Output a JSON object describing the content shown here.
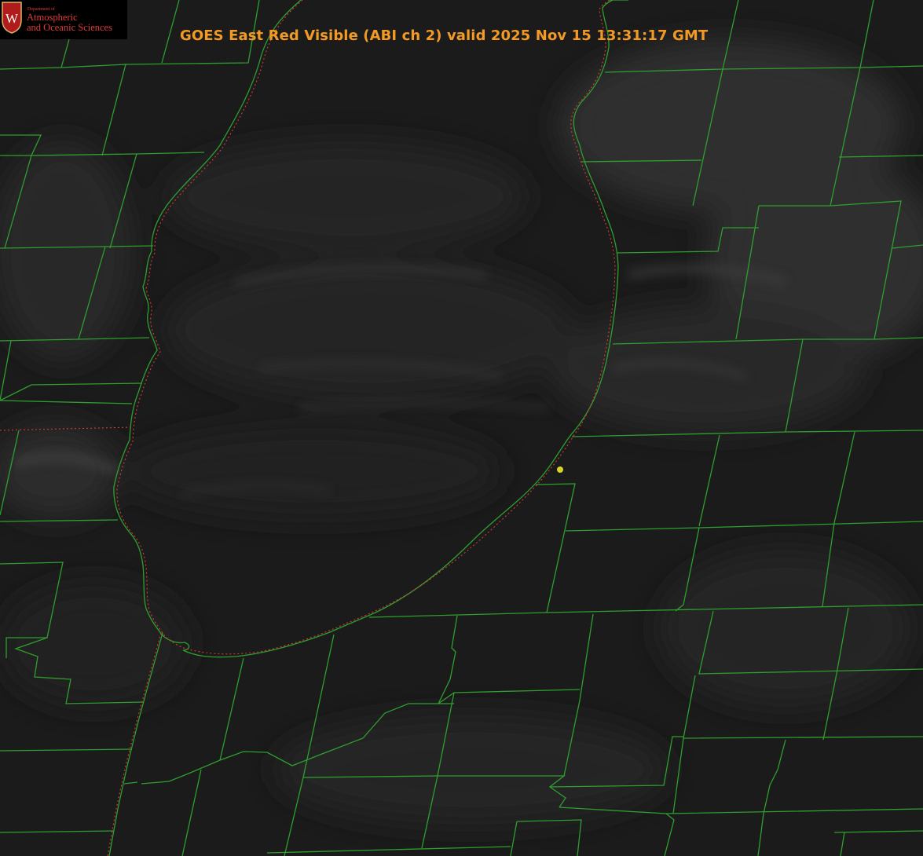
{
  "title": "GOES East Red Visible (ABI ch 2) valid 2025 Nov 15 13:31:17 GMT",
  "logo": {
    "dept": "Department of",
    "line1": "Atmospheric",
    "line2": "and Oceanic Sciences",
    "seal_letter": "W"
  },
  "colors": {
    "background": "#1b1b1b",
    "county_lines": "#2f9e2f",
    "state_line": "#d83a3a",
    "title": "#f39a25",
    "logo_text": "#e03a3a",
    "marker": "#d6d62a"
  },
  "marker": {
    "icon": "station-dot-icon"
  }
}
